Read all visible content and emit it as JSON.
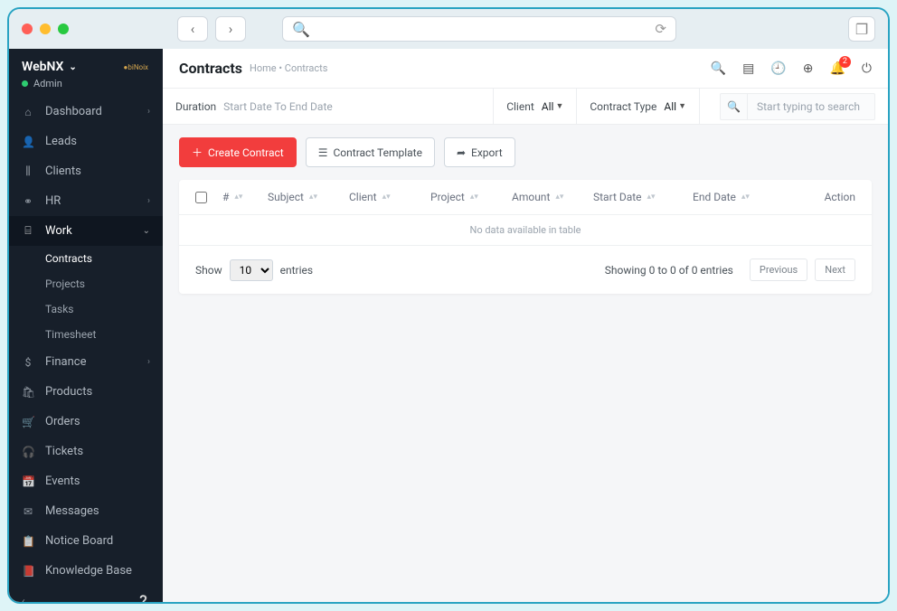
{
  "brand": "WebNX",
  "user_role": "Admin",
  "sidebar": [
    {
      "icon": "⌂",
      "label": "Dashboard",
      "arrow": "›"
    },
    {
      "icon": "👤",
      "label": "Leads"
    },
    {
      "icon": "⫼",
      "label": "Clients"
    },
    {
      "icon": "⚭",
      "label": "HR",
      "arrow": "›"
    },
    {
      "icon": "⌸",
      "label": "Work",
      "arrow": "⌄",
      "active": true,
      "subs": [
        {
          "label": "Contracts",
          "active": true
        },
        {
          "label": "Projects"
        },
        {
          "label": "Tasks"
        },
        {
          "label": "Timesheet"
        }
      ]
    },
    {
      "icon": "$",
      "label": "Finance",
      "arrow": "›"
    },
    {
      "icon": "🛍",
      "label": "Products"
    },
    {
      "icon": "🛒",
      "label": "Orders"
    },
    {
      "icon": "🎧",
      "label": "Tickets"
    },
    {
      "icon": "📅",
      "label": "Events"
    },
    {
      "icon": "✉",
      "label": "Messages"
    },
    {
      "icon": "📋",
      "label": "Notice Board"
    },
    {
      "icon": "📕",
      "label": "Knowledge Base"
    }
  ],
  "page": {
    "title": "Contracts",
    "breadcrumb": "Home • Contracts"
  },
  "notifications_count": "2",
  "filters": {
    "duration_label": "Duration",
    "duration_value": "Start Date To End Date",
    "client_label": "Client",
    "client_value": "All",
    "type_label": "Contract Type",
    "type_value": "All",
    "search_placeholder": "Start typing to search"
  },
  "buttons": {
    "create": "Create Contract",
    "template": "Contract Template",
    "export": "Export"
  },
  "table": {
    "columns": [
      "#",
      "Subject",
      "Client",
      "Project",
      "Amount",
      "Start Date",
      "End Date",
      "Action"
    ],
    "empty": "No data available in table",
    "show_label": "Show",
    "entries_label": "entries",
    "page_size": "10",
    "info": "Showing 0 to 0 of 0 entries",
    "prev": "Previous",
    "next": "Next"
  }
}
